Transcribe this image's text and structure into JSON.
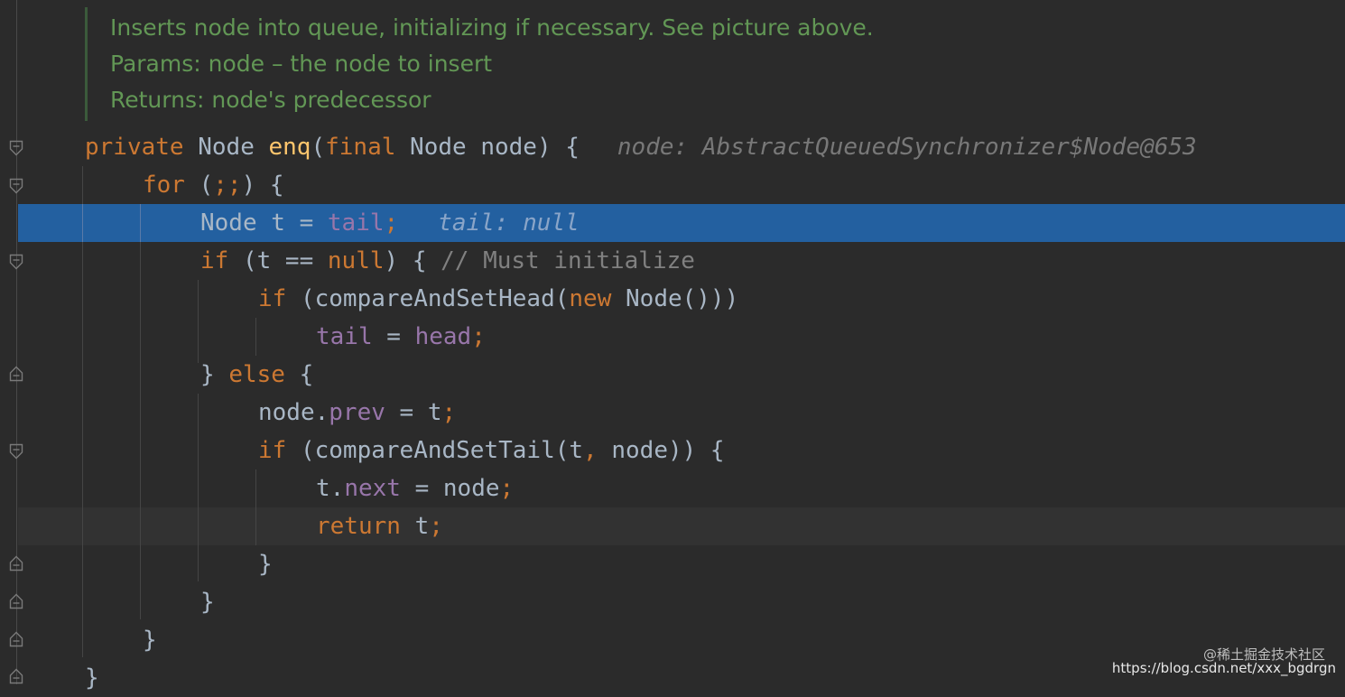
{
  "doc": [
    "Inserts node into queue, initializing if necessary. See picture above.",
    "Params:  node – the node to insert",
    "Returns: node's predecessor"
  ],
  "code": {
    "l1": {
      "kw1": "private",
      "t1": " Node ",
      "fn": "enq",
      "t2": "(",
      "kw2": "final",
      "t3": " Node node) {",
      "hint": "node: AbstractQueuedSynchronizer$Node@653"
    },
    "l2": {
      "kw": "for",
      "t": " (",
      "semi": ";;",
      "t2": ") {"
    },
    "l3": {
      "t": "Node t = ",
      "fld": "tail",
      "semi": ";",
      "hint": "tail: null"
    },
    "l4": {
      "kw": "if",
      "t": " (t == ",
      "kw2": "null",
      "t2": ") { ",
      "cmt": "// Must initialize"
    },
    "l5": {
      "kw": "if",
      "t": " (compareAndSetHead(",
      "kw2": "new",
      "t2": " Node()))"
    },
    "l6": {
      "fld": "tail",
      "t": " = ",
      "fld2": "head",
      "semi": ";"
    },
    "l7": {
      "t": "} ",
      "kw": "else",
      "t2": " {"
    },
    "l8": {
      "t": "node.",
      "fld": "prev",
      "t2": " = t",
      "semi": ";"
    },
    "l9": {
      "kw": "if",
      "t": " (compareAndSetTail(t",
      "comma": ",",
      "t2": " node)) {"
    },
    "l10": {
      "t": "t.",
      "fld": "next",
      "t2": " = node",
      "semi": ";"
    },
    "l11": {
      "kw": "return",
      "t": " t",
      "semi": ";"
    },
    "l12": "}",
    "l13": "}",
    "l14": "}",
    "l15": "}"
  },
  "watermark": {
    "line1": "@稀土掘金技术社区",
    "line2": "https://blog.csdn.net/xxx_bgdrgn"
  },
  "colors": {
    "background": "#2b2b2b",
    "selection": "#2360a0",
    "keyword": "#cc7832",
    "function": "#ffc66d",
    "field": "#9876aa",
    "doc": "#629755"
  }
}
